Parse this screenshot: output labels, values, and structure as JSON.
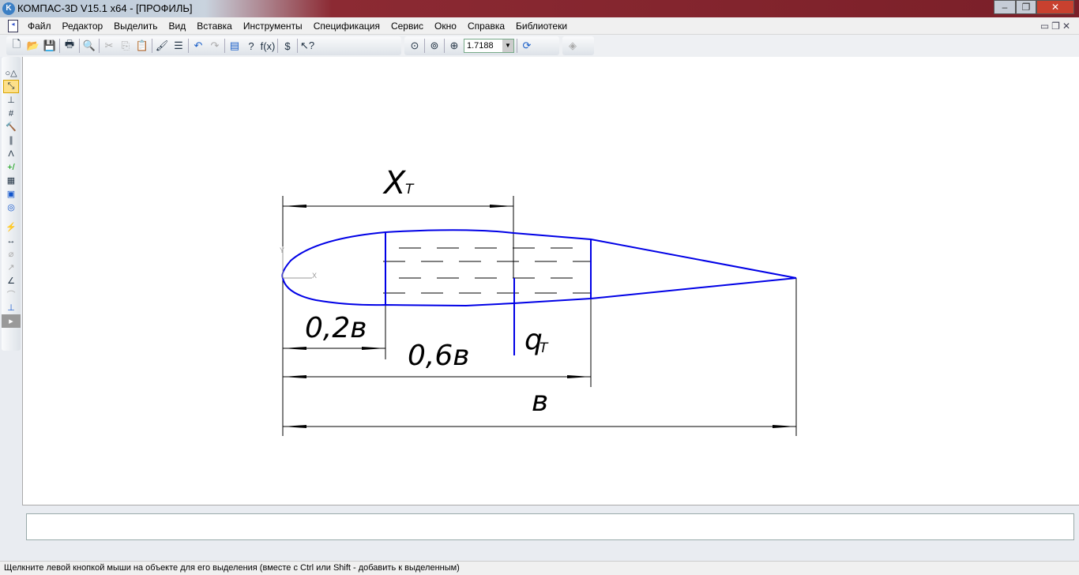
{
  "window": {
    "title": "КОМПАС-3D V15.1 x64 - [ПРОФИЛЬ]",
    "logo": "K"
  },
  "menu": [
    "Файл",
    "Редактор",
    "Выделить",
    "Вид",
    "Вставка",
    "Инструменты",
    "Спецификация",
    "Сервис",
    "Окно",
    "Справка",
    "Библиотеки"
  ],
  "toolbar": {
    "zoom_value": "1.7188"
  },
  "drawing": {
    "label_xt": "X",
    "label_xt_sub": "T",
    "label_02b": "0,2в",
    "label_06b": "0,6в",
    "label_qt": "q",
    "label_qt_sub": "T",
    "label_b": "в",
    "axis_x": "X",
    "axis_y": "Y"
  },
  "status": {
    "hint": "Щелкните левой кнопкой мыши на объекте для его выделения (вместе с Ctrl или Shift - добавить к выделенным)"
  }
}
